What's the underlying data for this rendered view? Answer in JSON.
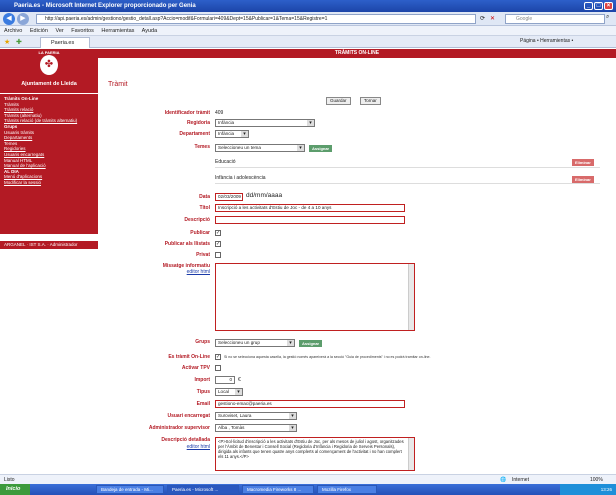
{
  "browser": {
    "title": "Paeria.es - Microsoft Internet Explorer proporcionado per Genia",
    "url": "http://api.paeria.es/admin/gestiono/gestio_detall.asp?Accio=modif&Formulari=409&Dept=15&Publicar=1&Tema=15&Registre=1",
    "search_placeholder": "Google",
    "menu": [
      "Archivo",
      "Edición",
      "Ver",
      "Favoritos",
      "Herramientas",
      "Ayuda"
    ],
    "tab_label": "Paeria.es",
    "toolbar_right": "Página • Herramientas •",
    "status_left": "Listo",
    "status_zone": "Internet",
    "status_zoom": "100%"
  },
  "sidebar": {
    "org": "LA PAERIA",
    "title": "Ajuntament de Lleida",
    "menu": [
      {
        "label": "Tràmits On-Line",
        "header": true
      },
      {
        "label": "Tràmits"
      },
      {
        "label": "Tràmits relació"
      },
      {
        "label": "Tràmits (alternatiu)"
      },
      {
        "label": "Tràmits relació (de tràmits alternatiu)"
      },
      {
        "label": "Grups",
        "header": true
      },
      {
        "label": "Usuaris tràmits"
      },
      {
        "label": "Departaments"
      },
      {
        "label": "Temes"
      },
      {
        "label": "Regidories"
      },
      {
        "label": "Usuaris encarregats"
      },
      {
        "label": "Manual HTML"
      },
      {
        "label": "Manual de l'aplicació"
      },
      {
        "label": "AL DIA",
        "header": true
      },
      {
        "label": "Menú d'aplicacions"
      },
      {
        "label": "Modificar la sessió"
      }
    ],
    "footer": "ARGANEL · IST S.A. · Administrador"
  },
  "content": {
    "banner": "TRÀMITS ON-LINE",
    "page_title": "Tràmit",
    "save_label": "Guardar",
    "back_label": "Tornar",
    "fields": {
      "id_label": "Identificador tràmit",
      "id_value": "409",
      "regidoria_label": "Regidoria",
      "regidoria_value": "Infància",
      "departament_label": "Departament",
      "departament_value": "Infància",
      "temes_label": "Temes",
      "temes_select": "Seleccioneu un tema",
      "assign_label": "Assignar",
      "temes_list": [
        "Educació",
        "Infància i adolescència"
      ],
      "delete_label": "Eliminar",
      "data_label": "Data",
      "data_value": "02/03/2009",
      "data_hint": "dd/mm/aaaa",
      "titol_label": "Títol",
      "titol_value": "Inscripció a les activitats d'Estiu de Joc - de 4 a 10 anys",
      "descripcio_label": "Descripció",
      "descripcio_value": "",
      "publicar_label": "Publicar",
      "publicar_llista_label": "Publicar als llistats",
      "privat_label": "Privat",
      "missatge_label": "Missatge informatiu",
      "editor_link": "editor html",
      "grups_label": "Grups",
      "grups_select": "Seleccioneu un grup",
      "online_label": "Es tràmit On-Line",
      "online_note": "Si no se selecciona aquesta casella, la gestió només apareixerà a la secció \"Guia de procediments\" i no es podrà tramitar on-line.",
      "tpv_label": "Activar TPV",
      "import_label": "Import",
      "import_value": "0",
      "import_unit": "€",
      "tipus_label": "Tipus",
      "tipus_value": "Local",
      "email_label": "Email",
      "email_value": "gestiono-emac@paeria.es",
      "usuari_label": "Usuari encarregat",
      "usuari_value": "Suroviset, Laura",
      "admin_label": "Administrador supervisor",
      "admin_value": "Alba , Tomàs",
      "detall_label": "Descripció detallada",
      "detall_value": "<P>Sol·licitud d'inscripció a les activitats d'Estiu de Joc, per als mesos de juliol i agost, organitzades per l'Àmbit de Benestar i Consell Social (Regidoria d'Infància i Regidoria de Serveis Personals), dirigida als infants que tenen quatre anys complerts al començament de l'activitat i no han complert els 11 anys.</P>"
    }
  },
  "taskbar": {
    "start": "Inicio",
    "tasks": [
      "Bandeja de entrada - Mi...",
      "Paeria.es - Microsoft ...",
      "Macromedia Fireworks 8 ...",
      "Mozilla Firefox"
    ],
    "clock": "13:26"
  },
  "colors": {
    "accent": "#b31a24",
    "link": "#1a3aa8",
    "assign": "#5c9d6c",
    "delete": "#d86a6a"
  }
}
